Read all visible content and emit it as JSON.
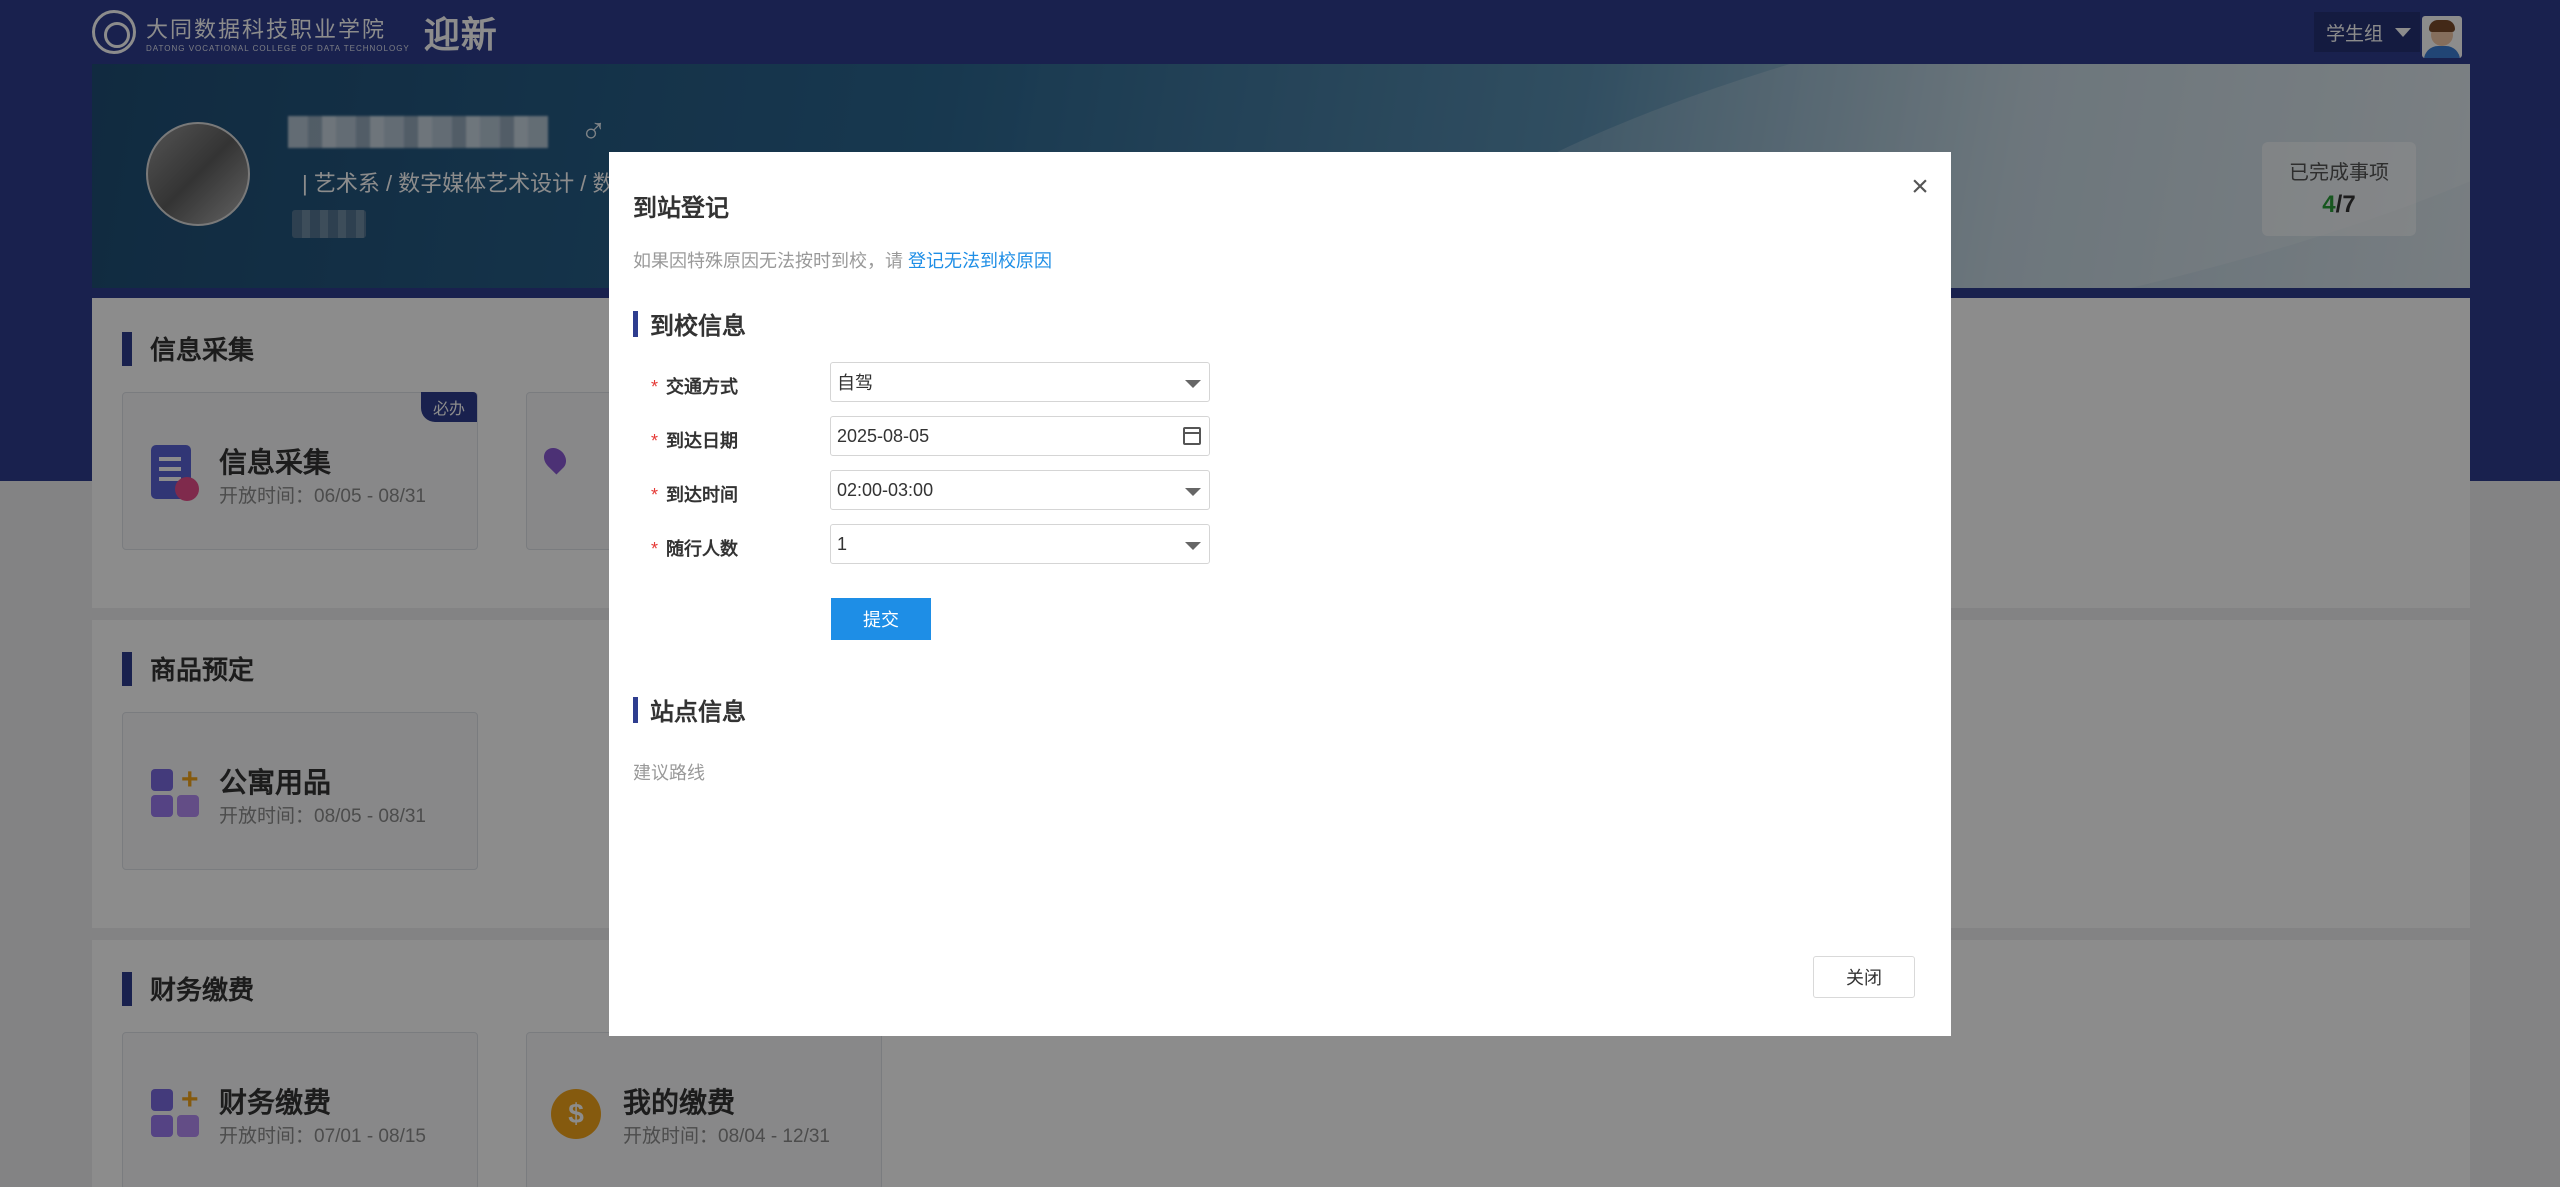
{
  "header": {
    "school_cn": "大同数据科技职业学院",
    "school_en": "DATONG VOCATIONAL COLLEGE OF DATA TECHNOLOGY",
    "app_name": "迎新",
    "user_group": "学生组"
  },
  "profile": {
    "gender_symbol": "♂",
    "dept_path": "| 艺术系 / 数字媒体艺术设计 / 数"
  },
  "progress": {
    "label": "已完成事项",
    "done": "4",
    "separator": "/",
    "total": "7"
  },
  "sections": [
    {
      "title": "信息采集",
      "cards": [
        {
          "name": "信息采集",
          "time": "开放时间：06/05 - 08/31",
          "badge": "必办",
          "icon": "form-icon"
        },
        {
          "icon": "location-pin-icon"
        }
      ]
    },
    {
      "title": "商品预定",
      "cards": [
        {
          "name": "公寓用品",
          "time": "开放时间：08/05 - 08/31",
          "icon": "blocks-plus-icon"
        }
      ]
    },
    {
      "title": "财务缴费",
      "cards": [
        {
          "name": "财务缴费",
          "time": "开放时间：07/01 - 08/15",
          "icon": "blocks-plus-icon"
        },
        {
          "name": "我的缴费",
          "time": "开放时间：08/04 - 12/31",
          "icon": "coin-icon"
        }
      ]
    }
  ],
  "modal": {
    "title": "到站登记",
    "close_glyph": "×",
    "notice_prefix": "如果因特殊原因无法按时到校，请",
    "notice_link": "登记无法到校原因",
    "section1": "到校信息",
    "fields": [
      {
        "label": "交通方式",
        "value": "自驾",
        "type": "select"
      },
      {
        "label": "到达日期",
        "value": "2025-08-05",
        "type": "date"
      },
      {
        "label": "到达时间",
        "value": "02:00-03:00",
        "type": "select"
      },
      {
        "label": "随行人数",
        "value": "1",
        "type": "select"
      }
    ],
    "required_mark": "*",
    "submit": "提交",
    "section2": "站点信息",
    "route_label": "建议路线",
    "close_button": "关闭"
  },
  "colors": {
    "primary": "#2e3d8f",
    "link": "#1e8ee6",
    "required": "#e53935",
    "progress_done": "#2a9d3a"
  }
}
